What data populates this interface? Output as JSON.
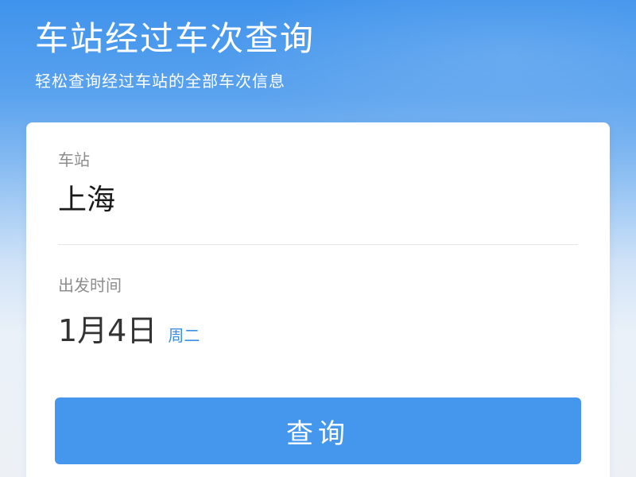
{
  "header": {
    "title": "车站经过车次查询",
    "subtitle": "轻松查询经过车站的全部车次信息"
  },
  "form": {
    "station": {
      "label": "车站",
      "value": "上海"
    },
    "departure": {
      "label": "出发时间",
      "date": "1月4日",
      "weekday": "周二"
    },
    "submit_label": "查询"
  },
  "colors": {
    "header_blue": "#3f93ec",
    "button_blue": "#4597ee",
    "weekday_blue": "#3b8ee6",
    "label_gray": "#8c8c8c",
    "value_black": "#1a1a1a"
  }
}
